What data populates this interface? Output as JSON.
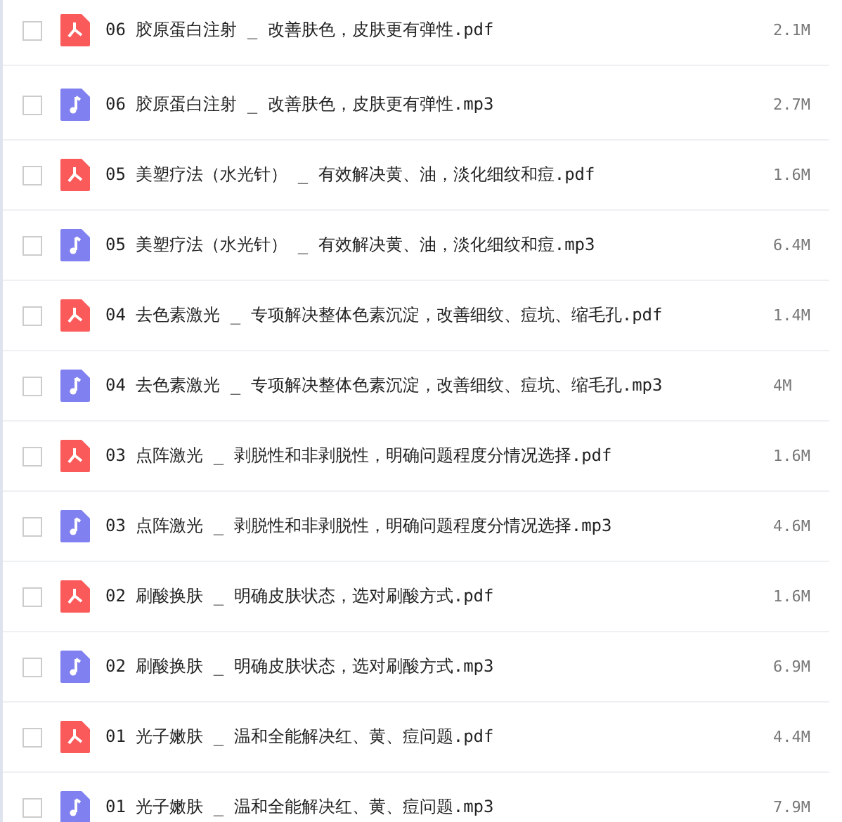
{
  "files": [
    {
      "kind": "pdf",
      "checked": false,
      "name": "06 胶原蛋白注射 _ 改善肤色，皮肤更有弹性.pdf",
      "size": "2.1M"
    },
    {
      "kind": "audio",
      "checked": false,
      "name": "06 胶原蛋白注射 _ 改善肤色，皮肤更有弹性.mp3",
      "size": "2.7M"
    },
    {
      "kind": "pdf",
      "checked": false,
      "name": "05 美塑疗法（水光针） _ 有效解决黄、油，淡化细纹和痘.pdf",
      "size": "1.6M"
    },
    {
      "kind": "audio",
      "checked": false,
      "name": "05 美塑疗法（水光针） _ 有效解决黄、油，淡化细纹和痘.mp3",
      "size": "6.4M"
    },
    {
      "kind": "pdf",
      "checked": false,
      "name": "04 去色素激光 _ 专项解决整体色素沉淀，改善细纹、痘坑、缩毛孔.pdf",
      "size": "1.4M"
    },
    {
      "kind": "audio",
      "checked": false,
      "name": "04 去色素激光 _ 专项解决整体色素沉淀，改善细纹、痘坑、缩毛孔.mp3",
      "size": "4M"
    },
    {
      "kind": "pdf",
      "checked": false,
      "name": "03 点阵激光 _ 剥脱性和非剥脱性，明确问题程度分情况选择.pdf",
      "size": "1.6M"
    },
    {
      "kind": "audio",
      "checked": false,
      "name": "03 点阵激光 _ 剥脱性和非剥脱性，明确问题程度分情况选择.mp3",
      "size": "4.6M"
    },
    {
      "kind": "pdf",
      "checked": false,
      "name": "02 刷酸换肤 _ 明确皮肤状态，选对刷酸方式.pdf",
      "size": "1.6M"
    },
    {
      "kind": "audio",
      "checked": false,
      "name": "02 刷酸换肤 _ 明确皮肤状态，选对刷酸方式.mp3",
      "size": "6.9M"
    },
    {
      "kind": "pdf",
      "checked": false,
      "name": "01 光子嫩肤 _ 温和全能解决红、黄、痘问题.pdf",
      "size": "4.4M"
    },
    {
      "kind": "audio",
      "checked": false,
      "name": "01 光子嫩肤 _ 温和全能解决红、黄、痘问题.mp3",
      "size": "7.9M"
    }
  ]
}
